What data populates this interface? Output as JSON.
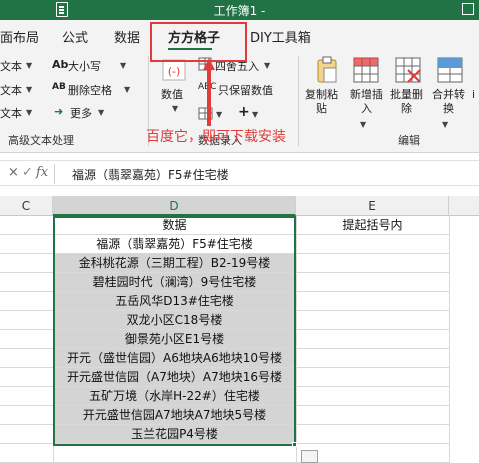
{
  "titlebar": {
    "title": "工作簿1 -"
  },
  "tabs": [
    {
      "label": "面布局",
      "active": false
    },
    {
      "label": "公式",
      "active": false
    },
    {
      "label": "数据",
      "active": false
    },
    {
      "label": "方方格子",
      "active": true
    },
    {
      "label": "DIY工具箱",
      "active": false
    }
  ],
  "ribbon": {
    "left_items": [
      "文本",
      "文本",
      "文本"
    ],
    "text_group": [
      "大小写",
      "删除空格",
      "更多"
    ],
    "numeric_label": "数值",
    "round_label": "四舍五入",
    "keep_numeric_label": "只保留数值",
    "right_buttons": [
      "复制粘\n贴",
      "新增插\n入",
      "批量删\n除",
      "合并转\n换"
    ],
    "group_labels": {
      "advanced_text": "高级文本处理",
      "numeric": "数据录入",
      "edit": "编辑"
    },
    "annotation": "百度它，即可下载安装"
  },
  "formula_bar": {
    "cancel": "×",
    "confirm": "✓",
    "fx": "fx",
    "content": "福源（翡翠嘉苑）F5#住宅楼"
  },
  "columns": [
    "C",
    "D",
    "E"
  ],
  "sheet": {
    "header_row": {
      "d": "数据",
      "e": "提起括号内"
    },
    "rows": [
      "福源（翡翠嘉苑）F5#住宅楼",
      "金科桃花源（三期工程）B2-19号楼",
      "碧桂园时代（澜湾）9号住宅楼",
      "五岳风华D13#住宅楼",
      "双龙小区C18号楼",
      "御景苑小区E1号楼",
      "开元（盛世信园）A6地块A6地块10号楼",
      "开元盛世信园（A7地块）A7地块16号楼",
      "五矿万境（水岸H-22#）住宅楼",
      "开元盛世信园A7地块A7地块5号楼",
      "玉兰花园P4号楼"
    ]
  },
  "colors": {
    "accent": "#217346",
    "annotation": "#e23b3b",
    "selected_fill": "#d4d4d4"
  }
}
